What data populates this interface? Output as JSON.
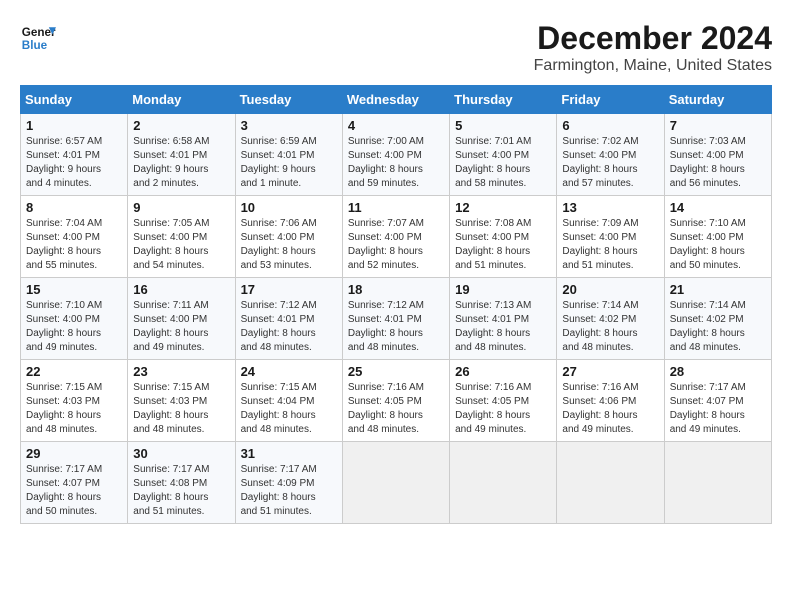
{
  "logo": {
    "line1": "General",
    "line2": "Blue"
  },
  "title": "December 2024",
  "subtitle": "Farmington, Maine, United States",
  "headers": [
    "Sunday",
    "Monday",
    "Tuesday",
    "Wednesday",
    "Thursday",
    "Friday",
    "Saturday"
  ],
  "weeks": [
    [
      {
        "day": "1",
        "info": "Sunrise: 6:57 AM\nSunset: 4:01 PM\nDaylight: 9 hours\nand 4 minutes."
      },
      {
        "day": "2",
        "info": "Sunrise: 6:58 AM\nSunset: 4:01 PM\nDaylight: 9 hours\nand 2 minutes."
      },
      {
        "day": "3",
        "info": "Sunrise: 6:59 AM\nSunset: 4:01 PM\nDaylight: 9 hours\nand 1 minute."
      },
      {
        "day": "4",
        "info": "Sunrise: 7:00 AM\nSunset: 4:00 PM\nDaylight: 8 hours\nand 59 minutes."
      },
      {
        "day": "5",
        "info": "Sunrise: 7:01 AM\nSunset: 4:00 PM\nDaylight: 8 hours\nand 58 minutes."
      },
      {
        "day": "6",
        "info": "Sunrise: 7:02 AM\nSunset: 4:00 PM\nDaylight: 8 hours\nand 57 minutes."
      },
      {
        "day": "7",
        "info": "Sunrise: 7:03 AM\nSunset: 4:00 PM\nDaylight: 8 hours\nand 56 minutes."
      }
    ],
    [
      {
        "day": "8",
        "info": "Sunrise: 7:04 AM\nSunset: 4:00 PM\nDaylight: 8 hours\nand 55 minutes."
      },
      {
        "day": "9",
        "info": "Sunrise: 7:05 AM\nSunset: 4:00 PM\nDaylight: 8 hours\nand 54 minutes."
      },
      {
        "day": "10",
        "info": "Sunrise: 7:06 AM\nSunset: 4:00 PM\nDaylight: 8 hours\nand 53 minutes."
      },
      {
        "day": "11",
        "info": "Sunrise: 7:07 AM\nSunset: 4:00 PM\nDaylight: 8 hours\nand 52 minutes."
      },
      {
        "day": "12",
        "info": "Sunrise: 7:08 AM\nSunset: 4:00 PM\nDaylight: 8 hours\nand 51 minutes."
      },
      {
        "day": "13",
        "info": "Sunrise: 7:09 AM\nSunset: 4:00 PM\nDaylight: 8 hours\nand 51 minutes."
      },
      {
        "day": "14",
        "info": "Sunrise: 7:10 AM\nSunset: 4:00 PM\nDaylight: 8 hours\nand 50 minutes."
      }
    ],
    [
      {
        "day": "15",
        "info": "Sunrise: 7:10 AM\nSunset: 4:00 PM\nDaylight: 8 hours\nand 49 minutes."
      },
      {
        "day": "16",
        "info": "Sunrise: 7:11 AM\nSunset: 4:00 PM\nDaylight: 8 hours\nand 49 minutes."
      },
      {
        "day": "17",
        "info": "Sunrise: 7:12 AM\nSunset: 4:01 PM\nDaylight: 8 hours\nand 48 minutes."
      },
      {
        "day": "18",
        "info": "Sunrise: 7:12 AM\nSunset: 4:01 PM\nDaylight: 8 hours\nand 48 minutes."
      },
      {
        "day": "19",
        "info": "Sunrise: 7:13 AM\nSunset: 4:01 PM\nDaylight: 8 hours\nand 48 minutes."
      },
      {
        "day": "20",
        "info": "Sunrise: 7:14 AM\nSunset: 4:02 PM\nDaylight: 8 hours\nand 48 minutes."
      },
      {
        "day": "21",
        "info": "Sunrise: 7:14 AM\nSunset: 4:02 PM\nDaylight: 8 hours\nand 48 minutes."
      }
    ],
    [
      {
        "day": "22",
        "info": "Sunrise: 7:15 AM\nSunset: 4:03 PM\nDaylight: 8 hours\nand 48 minutes."
      },
      {
        "day": "23",
        "info": "Sunrise: 7:15 AM\nSunset: 4:03 PM\nDaylight: 8 hours\nand 48 minutes."
      },
      {
        "day": "24",
        "info": "Sunrise: 7:15 AM\nSunset: 4:04 PM\nDaylight: 8 hours\nand 48 minutes."
      },
      {
        "day": "25",
        "info": "Sunrise: 7:16 AM\nSunset: 4:05 PM\nDaylight: 8 hours\nand 48 minutes."
      },
      {
        "day": "26",
        "info": "Sunrise: 7:16 AM\nSunset: 4:05 PM\nDaylight: 8 hours\nand 49 minutes."
      },
      {
        "day": "27",
        "info": "Sunrise: 7:16 AM\nSunset: 4:06 PM\nDaylight: 8 hours\nand 49 minutes."
      },
      {
        "day": "28",
        "info": "Sunrise: 7:17 AM\nSunset: 4:07 PM\nDaylight: 8 hours\nand 49 minutes."
      }
    ],
    [
      {
        "day": "29",
        "info": "Sunrise: 7:17 AM\nSunset: 4:07 PM\nDaylight: 8 hours\nand 50 minutes."
      },
      {
        "day": "30",
        "info": "Sunrise: 7:17 AM\nSunset: 4:08 PM\nDaylight: 8 hours\nand 51 minutes."
      },
      {
        "day": "31",
        "info": "Sunrise: 7:17 AM\nSunset: 4:09 PM\nDaylight: 8 hours\nand 51 minutes."
      },
      {
        "day": "",
        "info": ""
      },
      {
        "day": "",
        "info": ""
      },
      {
        "day": "",
        "info": ""
      },
      {
        "day": "",
        "info": ""
      }
    ]
  ]
}
